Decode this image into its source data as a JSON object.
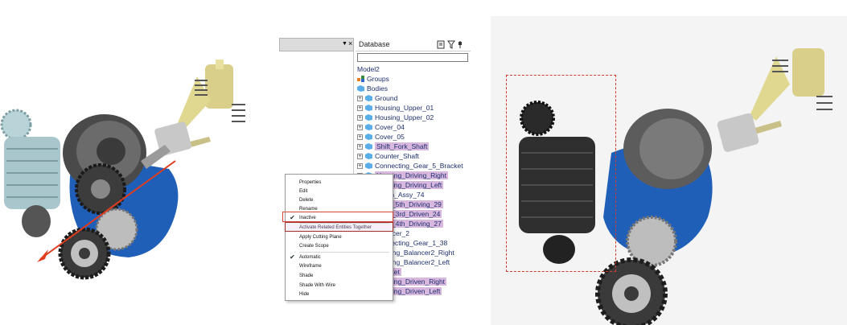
{
  "database_panel": {
    "title": "Database",
    "search_value": "",
    "model_name": "Model2",
    "groups_label": "Groups",
    "bodies_label": "Bodies",
    "bodies": [
      {
        "label": "Ground",
        "highlight": false
      },
      {
        "label": "Housing_Upper_01",
        "highlight": false
      },
      {
        "label": "Housing_Upper_02",
        "highlight": false
      },
      {
        "label": "Cover_04",
        "highlight": false
      },
      {
        "label": "Cover_05",
        "highlight": false
      },
      {
        "label": "Shift_Fork_Shaft",
        "highlight": true
      },
      {
        "label": "Counter_Shaft",
        "highlight": false
      },
      {
        "label": "Connecting_Gear_5_Bracket",
        "highlight": false
      },
      {
        "label": "Housing_Driving_Right",
        "highlight": true
      },
      {
        "label": "Housing_Driving_Left",
        "highlight": true
      },
      {
        "label": "Clutch_Assy_74",
        "highlight": false
      },
      {
        "label": "Gear_5th_Driving_29",
        "highlight": true
      },
      {
        "label": "Gear_3rd_Driven_24",
        "highlight": true
      },
      {
        "label": "Gear_4th_Driving_27",
        "highlight": true
      },
      {
        "label": "Balancer_2",
        "highlight": false
      },
      {
        "label": "Connecting_Gear_1_38",
        "highlight": false
      },
      {
        "label": "Housing_Balancer2_Right",
        "highlight": false
      },
      {
        "label": "Housing_Balancer2_Left",
        "highlight": false
      },
      {
        "label": "Bracket",
        "highlight": true
      },
      {
        "label": "Housing_Driven_Right",
        "highlight": true
      },
      {
        "label": "Housing_Driven_Left",
        "highlight": true
      }
    ]
  },
  "context_menu": {
    "items": [
      {
        "label": "Properties",
        "checked": false
      },
      {
        "label": "Edit",
        "checked": false
      },
      {
        "label": "Delete",
        "checked": false
      },
      {
        "label": "Rename",
        "checked": false
      },
      {
        "label": "Inactive",
        "checked": true
      },
      {
        "label": "Activate Related Entities Together",
        "checked": false
      },
      {
        "label": "Apply Cutting Plane",
        "checked": false
      },
      {
        "label": "Create Scope",
        "checked": false
      },
      {
        "label": "Automatic",
        "checked": true
      },
      {
        "label": "Wireframe",
        "checked": false
      },
      {
        "label": "Shade",
        "checked": false
      },
      {
        "label": "Shade With Wire",
        "checked": false
      },
      {
        "label": "Hide",
        "checked": false
      }
    ]
  },
  "colors": {
    "highlight": "#d9b8e0",
    "focus_box": "#d23c2e",
    "body_blue": "#1f5fb8",
    "gear_dark": "#2a2a2a",
    "gear_light": "#b8d4d8",
    "spring_yellow": "#e8e0a0"
  }
}
